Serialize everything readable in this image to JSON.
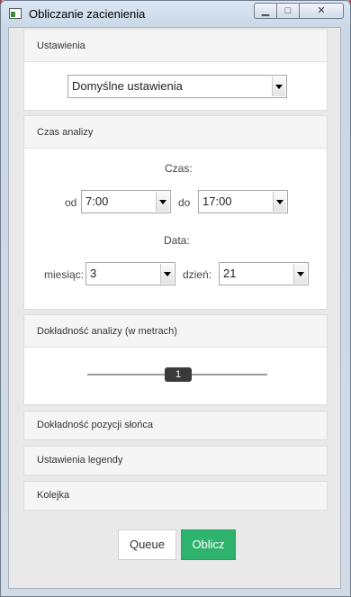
{
  "window": {
    "title": "Obliczanie zacienienia",
    "minimize_label": "▁",
    "maximize_label": "□",
    "close_label": "✕"
  },
  "settings": {
    "header": "Ustawienia",
    "preset_value": "Domyślne ustawienia"
  },
  "analysis_time": {
    "header": "Czas analizy",
    "time_label": "Czas:",
    "from_label": "od",
    "from_value": "7:00",
    "to_label": "do",
    "to_value": "17:00",
    "date_label": "Data:",
    "month_label": "miesiąc:",
    "month_value": "3",
    "day_label": "dzień:",
    "day_value": "21"
  },
  "accuracy": {
    "header": "Dokładność analizy (w metrach)",
    "slider_value": "1"
  },
  "sun_accuracy": {
    "header": "Dokładność pozycji słońca"
  },
  "legend": {
    "header": "Ustawienia legendy"
  },
  "queue_panel": {
    "header": "Kolejka"
  },
  "actions": {
    "queue_label": "Queue",
    "compute_label": "Oblicz"
  },
  "colors": {
    "compute_button": "#2db36b",
    "slider_thumb": "#3a3a3a"
  }
}
